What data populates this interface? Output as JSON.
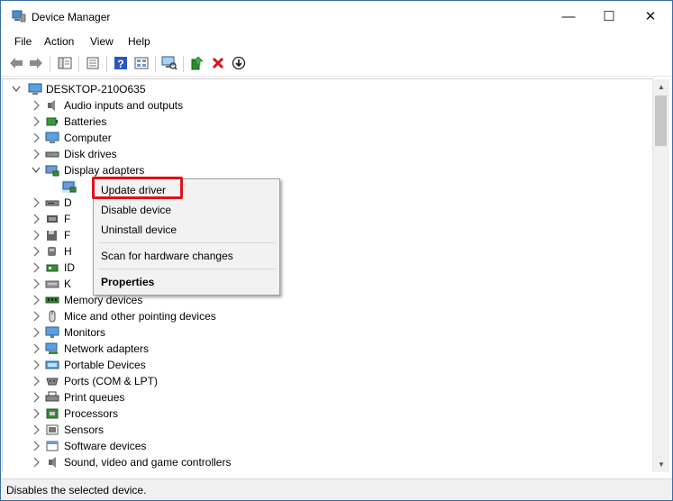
{
  "window": {
    "title": "Device Manager"
  },
  "window_controls": {
    "minimize": "—",
    "maximize": "☐",
    "close": "✕"
  },
  "menu": [
    "File",
    "Action",
    "View",
    "Help"
  ],
  "toolbar": [
    "back-arrow-icon",
    "forward-arrow-icon",
    "show-hide-console-tree-icon",
    "properties-icon",
    "help-icon",
    "view-icon",
    "scan-hardware-icon",
    "update-driver-icon",
    "uninstall-device-icon",
    "disable-device-icon"
  ],
  "tree": {
    "root": "DESKTOP-210O635",
    "items": [
      {
        "label": "Audio inputs and outputs",
        "icon": "speaker-icon",
        "expanded": false
      },
      {
        "label": "Batteries",
        "icon": "battery-icon",
        "expanded": false
      },
      {
        "label": "Computer",
        "icon": "computer-icon",
        "expanded": false
      },
      {
        "label": "Disk drives",
        "icon": "disk-drive-icon",
        "expanded": false
      },
      {
        "label": "Display adapters",
        "icon": "display-adapter-icon",
        "expanded": true
      },
      {
        "label": "",
        "icon": "display-adapter-icon",
        "expanded": null,
        "child": true
      },
      {
        "label": "D",
        "icon": "dvd-drive-icon",
        "expanded": false
      },
      {
        "label": "F",
        "icon": "firmware-icon",
        "expanded": false
      },
      {
        "label": "F",
        "icon": "floppy-icon",
        "expanded": false
      },
      {
        "label": "H",
        "icon": "hid-icon",
        "expanded": false
      },
      {
        "label": "ID",
        "icon": "ide-controller-icon",
        "expanded": false
      },
      {
        "label": "K",
        "icon": "keyboard-icon",
        "expanded": false
      },
      {
        "label": "Memory devices",
        "icon": "memory-icon",
        "expanded": false
      },
      {
        "label": "Mice and other pointing devices",
        "icon": "mouse-icon",
        "expanded": false
      },
      {
        "label": "Monitors",
        "icon": "monitor-icon",
        "expanded": false
      },
      {
        "label": "Network adapters",
        "icon": "network-adapter-icon",
        "expanded": false
      },
      {
        "label": "Portable Devices",
        "icon": "portable-device-icon",
        "expanded": false
      },
      {
        "label": "Ports (COM & LPT)",
        "icon": "port-icon",
        "expanded": false
      },
      {
        "label": "Print queues",
        "icon": "printer-icon",
        "expanded": false
      },
      {
        "label": "Processors",
        "icon": "processor-icon",
        "expanded": false
      },
      {
        "label": "Sensors",
        "icon": "sensor-icon",
        "expanded": false
      },
      {
        "label": "Software devices",
        "icon": "software-device-icon",
        "expanded": false
      },
      {
        "label": "Sound, video and game controllers",
        "icon": "sound-controller-icon",
        "expanded": false
      }
    ]
  },
  "context_menu": {
    "update_driver": "Update driver",
    "disable_device": "Disable device",
    "uninstall_device": "Uninstall device",
    "scan_hardware": "Scan for hardware changes",
    "properties": "Properties"
  },
  "status": "Disables the selected device.",
  "colors": {
    "highlight_box": "#e0121a",
    "selection": "#cce8ff",
    "folder_blue": "#1e6fbf"
  }
}
